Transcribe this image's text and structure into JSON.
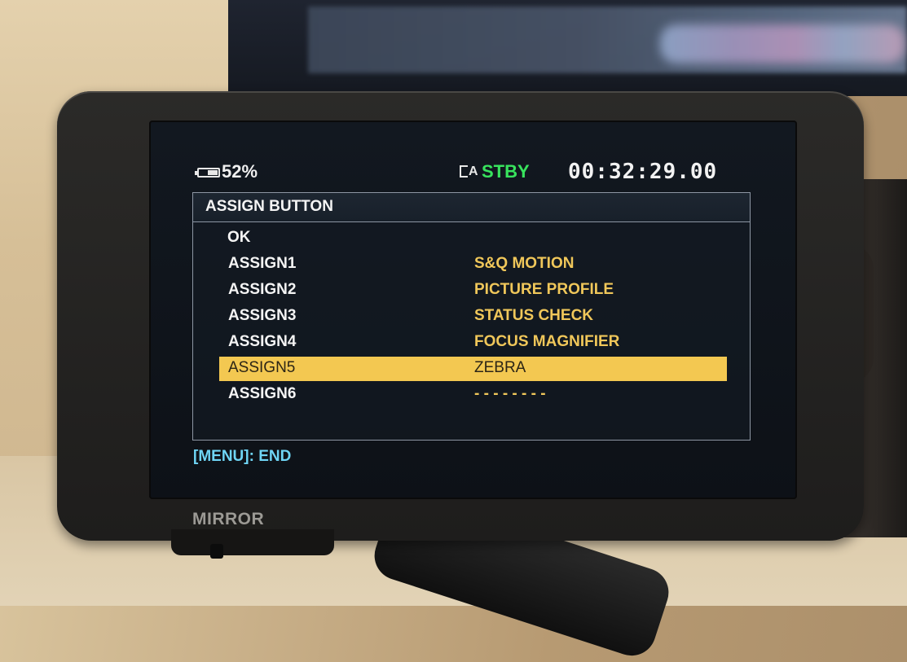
{
  "status": {
    "battery_percent": "52%",
    "battery_level": 0.52,
    "media_indicator": "A",
    "mode": "STBY",
    "timecode": "00:32:29.00"
  },
  "menu": {
    "title": "ASSIGN BUTTON",
    "items": [
      {
        "label": "OK",
        "value": ""
      },
      {
        "label": "ASSIGN1",
        "value": "S&Q MOTION"
      },
      {
        "label": "ASSIGN2",
        "value": "PICTURE PROFILE"
      },
      {
        "label": "ASSIGN3",
        "value": "STATUS CHECK"
      },
      {
        "label": "ASSIGN4",
        "value": "FOCUS MAGNIFIER"
      },
      {
        "label": "ASSIGN5",
        "value": "ZEBRA"
      },
      {
        "label": "ASSIGN6",
        "value": "- - - - - - - -"
      }
    ],
    "selected_index": 5
  },
  "footer_hint": "[MENU]: END",
  "body_label": "MIRROR",
  "colors": {
    "selection": "#f3c851",
    "value_text": "#f0c75a",
    "stby": "#38e35d",
    "hint": "#6fd5f5"
  }
}
